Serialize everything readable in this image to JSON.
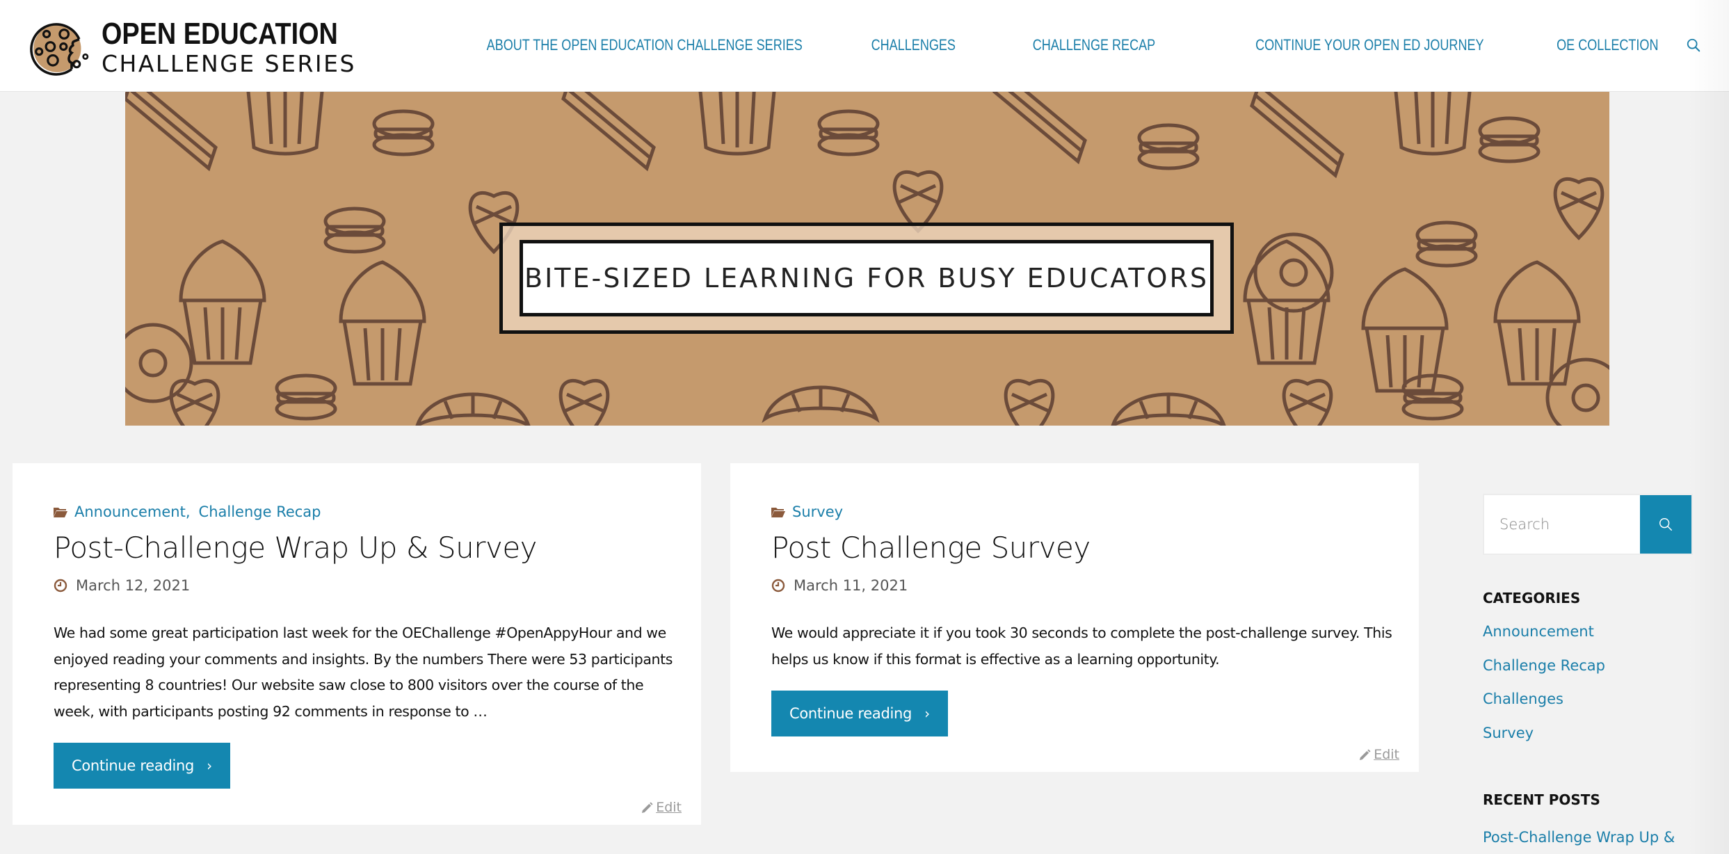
{
  "header": {
    "logo": {
      "line1": "OPEN EDUCATION",
      "line2": "CHALLENGE SERIES",
      "icon": "cookie-icon"
    },
    "nav": [
      {
        "label": "ABOUT THE OPEN EDUCATION CHALLENGE SERIES"
      },
      {
        "label": "CHALLENGES"
      },
      {
        "label": "CHALLENGE RECAP"
      },
      {
        "label": "CONTINUE YOUR OPEN ED JOURNEY"
      },
      {
        "label": "OE COLLECTION"
      }
    ],
    "search_icon": "search-icon"
  },
  "banner": {
    "title": "BITE-SIZED LEARNING FOR BUSY EDUCATORS",
    "background_color": "#c59a6d"
  },
  "posts": [
    {
      "categories": [
        "Announcement",
        "Challenge Recap"
      ],
      "separator": ",",
      "title": "Post-Challenge Wrap Up & Survey",
      "date": "March 12, 2021",
      "excerpt": "We had some great participation last week for the OEChallenge #OpenAppyHour and we enjoyed reading your comments and insights. By the numbers There were 53 participants representing 8 countries!  Our website saw close to 800 visitors over the course of the week, with participants posting 92 comments in response to …",
      "continue_label": "Continue reading",
      "continue_chevron": "›",
      "edit_label": "Edit"
    },
    {
      "categories": [
        "Survey"
      ],
      "title": "Post Challenge Survey",
      "date": "March 11, 2021",
      "excerpt": "We would appreciate it if you took 30 seconds to complete the post-challenge survey. This helps us know if this format is effective as a learning opportunity.",
      "continue_label": "Continue reading",
      "continue_chevron": "›",
      "edit_label": "Edit"
    }
  ],
  "sidebar": {
    "search": {
      "placeholder": "Search",
      "value": ""
    },
    "categories": {
      "title": "CATEGORIES",
      "items": [
        "Announcement",
        "Challenge Recap",
        "Challenges",
        "Survey"
      ]
    },
    "recent_posts": {
      "title": "RECENT POSTS",
      "items": [
        "Post-Challenge Wrap Up &"
      ]
    }
  },
  "colors": {
    "accent": "#1487b0",
    "link": "#1a7ea9",
    "icon_brown": "#8b5a3c",
    "page_bg": "#f2f2f2"
  }
}
